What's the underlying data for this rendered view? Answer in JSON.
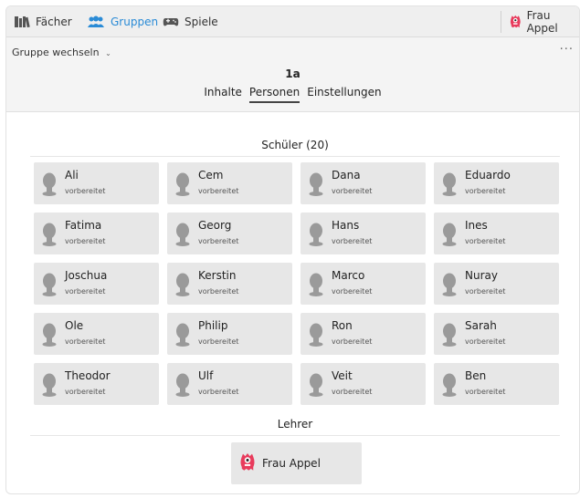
{
  "nav": {
    "items": [
      {
        "label": "Fächer"
      },
      {
        "label": "Gruppen"
      },
      {
        "label": "Spiele"
      }
    ],
    "user": "Frau Appel"
  },
  "subheader": {
    "switch_label": "Gruppe wechseln",
    "more": "···",
    "group_name": "1a",
    "tabs": [
      {
        "label": "Inhalte"
      },
      {
        "label": "Personen"
      },
      {
        "label": "Einstellungen"
      }
    ]
  },
  "students": {
    "title": "Schüler (20)",
    "list": [
      {
        "name": "Ali",
        "status": "vorbereitet"
      },
      {
        "name": "Cem",
        "status": "vorbereitet"
      },
      {
        "name": "Dana",
        "status": "vorbereitet"
      },
      {
        "name": "Eduardo",
        "status": "vorbereitet"
      },
      {
        "name": "Fatima",
        "status": "vorbereitet"
      },
      {
        "name": "Georg",
        "status": "vorbereitet"
      },
      {
        "name": "Hans",
        "status": "vorbereitet"
      },
      {
        "name": "Ines",
        "status": "vorbereitet"
      },
      {
        "name": "Joschua",
        "status": "vorbereitet"
      },
      {
        "name": "Kerstin",
        "status": "vorbereitet"
      },
      {
        "name": "Marco",
        "status": "vorbereitet"
      },
      {
        "name": "Nuray",
        "status": "vorbereitet"
      },
      {
        "name": "Ole",
        "status": "vorbereitet"
      },
      {
        "name": "Philip",
        "status": "vorbereitet"
      },
      {
        "name": "Ron",
        "status": "vorbereitet"
      },
      {
        "name": "Sarah",
        "status": "vorbereitet"
      },
      {
        "name": "Theodor",
        "status": "vorbereitet"
      },
      {
        "name": "Ulf",
        "status": "vorbereitet"
      },
      {
        "name": "Veit",
        "status": "vorbereitet"
      },
      {
        "name": "Ben",
        "status": "vorbereitet"
      }
    ]
  },
  "teachers": {
    "title": "Lehrer",
    "list": [
      {
        "name": "Frau Appel"
      }
    ]
  },
  "colors": {
    "accent": "#2a8bd6",
    "card": "#e7e7e7",
    "avatar": "#9a9a9a",
    "monster": "#e83b5c"
  }
}
